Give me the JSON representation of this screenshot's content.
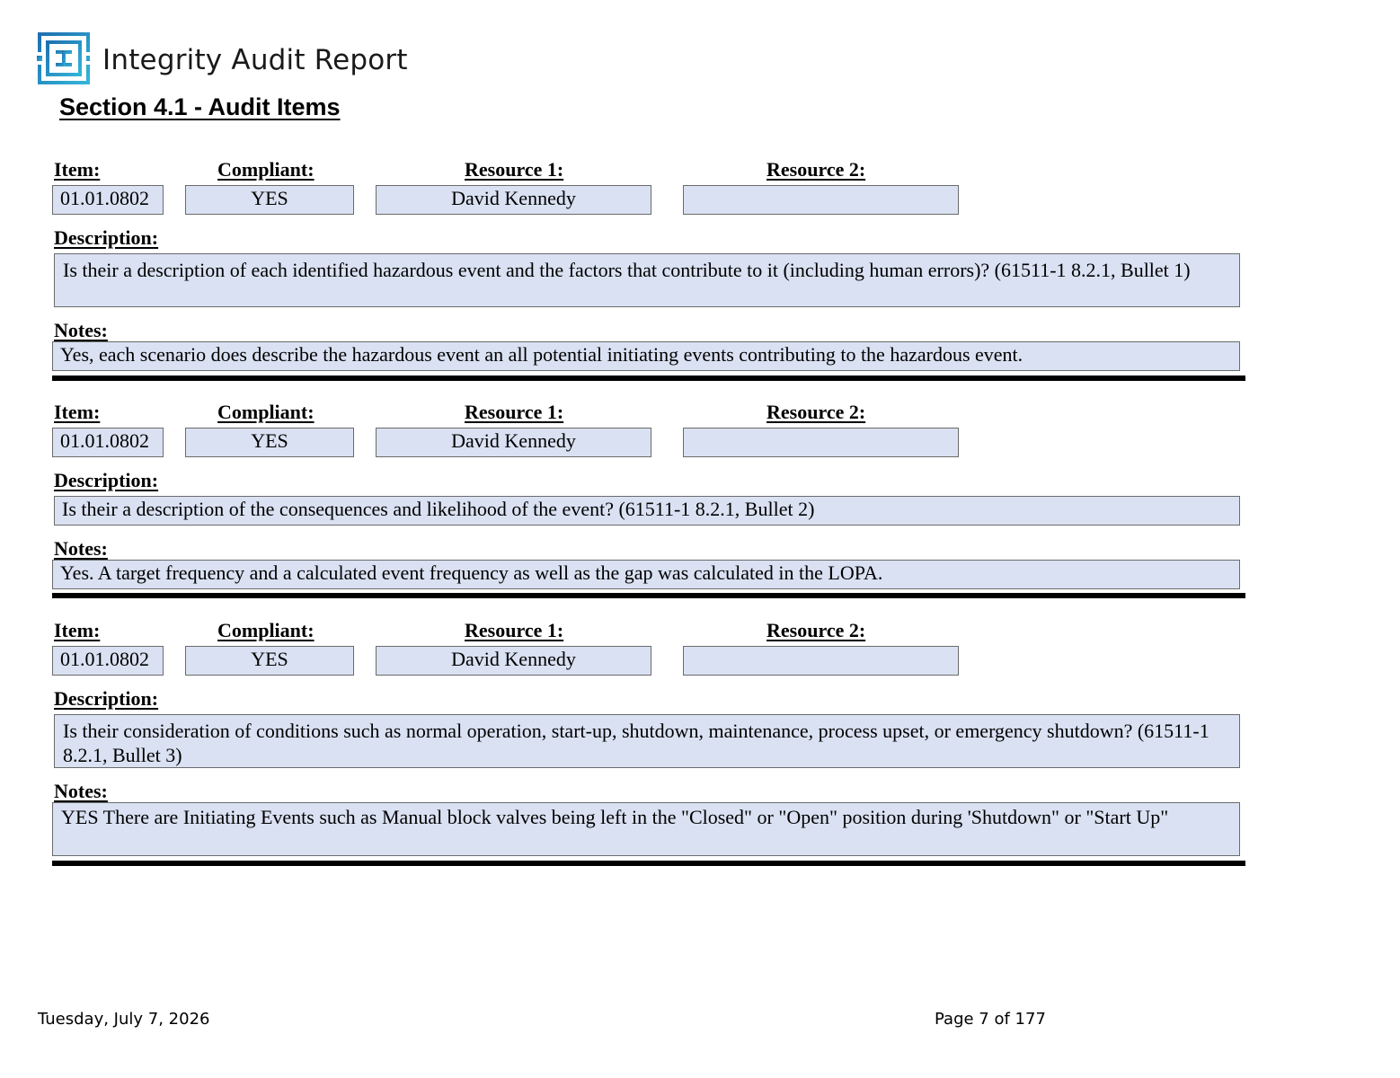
{
  "header": {
    "logo_name": "integrity-logo",
    "title": "Integrity Audit Report"
  },
  "section": {
    "title": "Section 4.1 - Audit Items"
  },
  "labels": {
    "item": "Item:",
    "compliant": "Compliant:",
    "resource1": "Resource 1:",
    "resource2": "Resource 2:",
    "description": "Description:",
    "notes": "Notes:"
  },
  "items": [
    {
      "item": "01.01.0802",
      "compliant": "YES",
      "resource1": "David Kennedy",
      "resource2": "",
      "description": "Is their a description of each identified hazardous event and the factors that contribute to it (including human errors)? (61511-1 8.2.1, Bullet 1)",
      "notes": "Yes, each scenario does describe the hazardous event an all potential initiating events contributing to the hazardous event."
    },
    {
      "item": "01.01.0802",
      "compliant": "YES",
      "resource1": "David Kennedy",
      "resource2": "",
      "description": "Is their a description of the consequences and likelihood of the event? (61511-1 8.2.1, Bullet 2)",
      "notes": "Yes.  A target frequency and a calculated event frequency as well as the gap was calculated in the LOPA."
    },
    {
      "item": "01.01.0802",
      "compliant": "YES",
      "resource1": "David Kennedy",
      "resource2": "",
      "description": "Is their consideration of conditions such as normal operation, start-up, shutdown, maintenance, process upset, or emergency shutdown? (61511-1 8.2.1, Bullet 3)",
      "notes": "YES There are Initiating Events such as Manual block valves being left in the \"Closed\" or \"Open\" position during 'Shutdown\" or \"Start Up\""
    }
  ],
  "footer": {
    "date": "Tuesday, July 7, 2026",
    "page": "Page 7 of 177"
  },
  "colors": {
    "field_bg": "#d9e1f2",
    "logo_blue": "#2a8fc4"
  }
}
